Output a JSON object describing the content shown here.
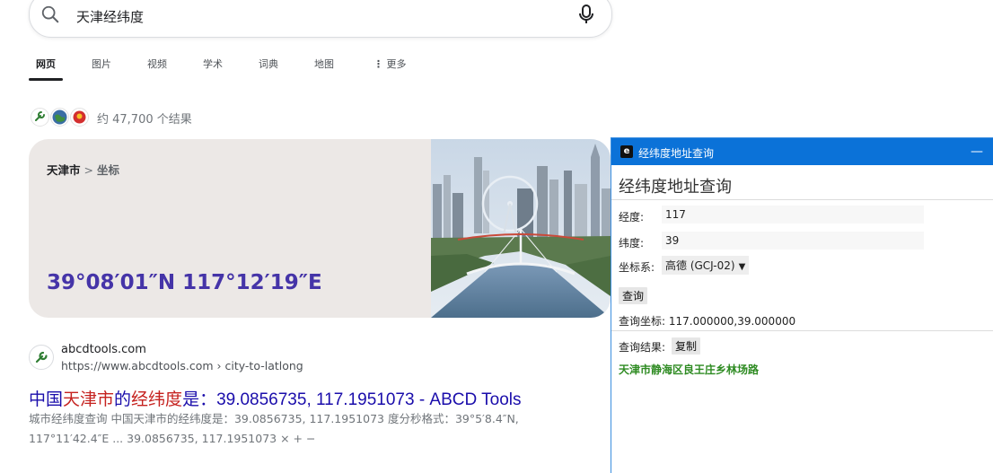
{
  "search": {
    "query": "天津经纬度"
  },
  "tabs": [
    "网页",
    "图片",
    "视频",
    "学术",
    "词典",
    "地图",
    "更多"
  ],
  "result_count": "约 47,700 个结果",
  "coord_card": {
    "crumb_city": "天津市",
    "crumb_sep": ">",
    "crumb_topic": "坐标",
    "coordinates": "39°08′01″N 117°12′19″E"
  },
  "organic": {
    "site_name": "abcdtools.com",
    "site_url": "https://www.abcdtools.com › city-to-latlong",
    "title_prefix": "中国",
    "title_hl1": "天津市",
    "title_mid": "的",
    "title_hl2": "经纬度",
    "title_suffix": "是：39.0856735, 117.1951073 - ABCD Tools",
    "snippet": "城市经纬度查询 中国天津市的经纬度是：39.0856735, 117.1951073 度分秒格式：39°5′8.4″N, 117°11′42.4″E ... 39.0856735, 117.1951073 × + −"
  },
  "popup": {
    "app_icon": "e",
    "window_title": "经纬度地址查询",
    "minimize": "—",
    "heading": "经纬度地址查询",
    "lng_label": "经度:",
    "lng_value": "117",
    "lat_label": "纬度:",
    "lat_value": "39",
    "crs_label": "坐标系:",
    "crs_value": "高德 (GCJ-02)",
    "query_button": "查询",
    "query_coord": "查询坐标: 117.000000,39.000000",
    "result_label": "查询结果:",
    "copy_button": "复制",
    "result_text": "天津市静海区良王庄乡林场路"
  },
  "colors": {
    "coord_text": "#4534a8",
    "link": "#1a0dab",
    "highlight": "#c5221f",
    "titlebar": "#0b72d8",
    "result_green": "#2e8b22"
  }
}
